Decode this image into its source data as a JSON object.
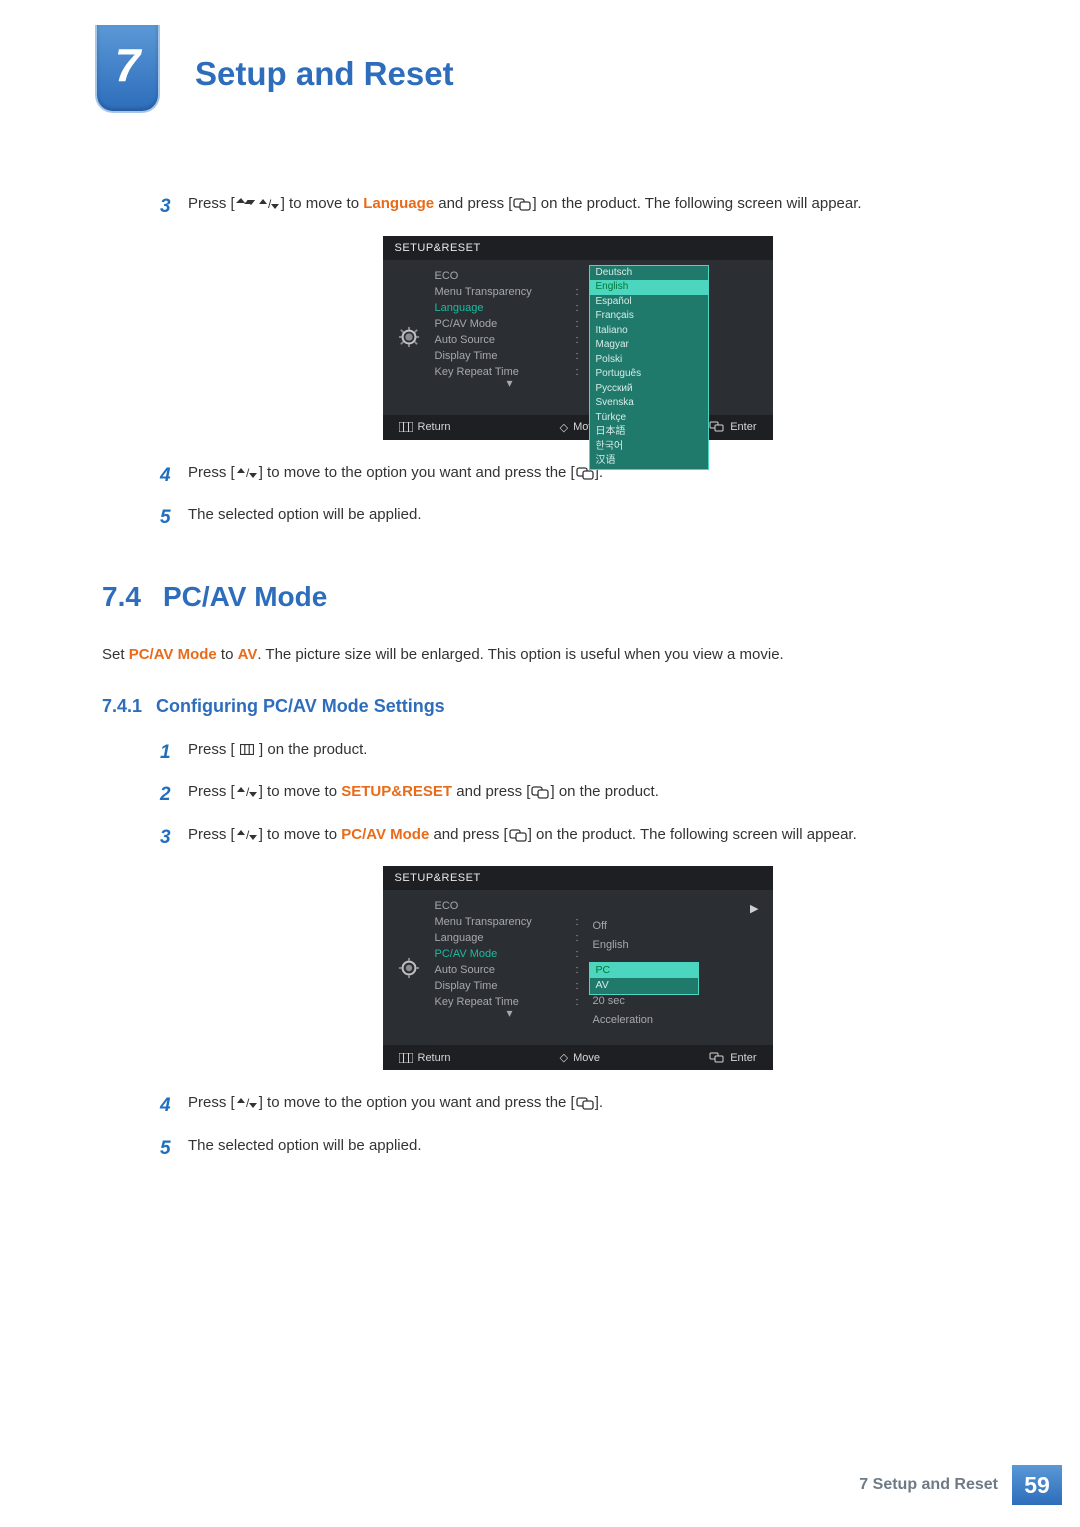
{
  "header": {
    "chapter_number": "7",
    "chapter_title": "Setup and Reset"
  },
  "steps_a": {
    "s3": {
      "num": "3",
      "pre": "Press [",
      "mid1": "] to move to ",
      "hl": "Language",
      "mid2": " and press [",
      "post": "] on the product. The following screen will appear."
    },
    "s4": {
      "num": "4",
      "pre": "Press [",
      "mid": "] to move to the option you want and press the [",
      "post": "]."
    },
    "s5": {
      "num": "5",
      "text": "The selected option will be applied."
    }
  },
  "osd1": {
    "title": "SETUP&RESET",
    "items": [
      "ECO",
      "Menu Transparency",
      "Language",
      "PC/AV Mode",
      "Auto Source",
      "Display Time",
      "Key Repeat Time"
    ],
    "selected_index": 2,
    "dropdown": [
      "Deutsch",
      "English",
      "Español",
      "Français",
      "Italiano",
      "Magyar",
      "Polski",
      "Português",
      "Русский",
      "Svenska",
      "Türkçe",
      "日本語",
      "한국어",
      "汉语"
    ],
    "dropdown_hl_index": 1,
    "footer": {
      "return": "Return",
      "move": "Move",
      "enter": "Enter"
    }
  },
  "section": {
    "num": "7.4",
    "title": "PC/AV Mode"
  },
  "body_text": {
    "pre": "Set ",
    "hl1": "PC/AV Mode",
    "mid": " to ",
    "hl2": "AV",
    "post": ". The picture size will be enlarged. This option is useful when you view a movie."
  },
  "subsection": {
    "num": "7.4.1",
    "title": "Configuring PC/AV Mode Settings"
  },
  "steps_b": {
    "s1": {
      "num": "1",
      "pre": "Press [ ",
      "post": " ] on the product."
    },
    "s2": {
      "num": "2",
      "pre": "Press [",
      "mid1": "] to move to ",
      "hl": "SETUP&RESET",
      "mid2": " and press [",
      "post": "] on the product."
    },
    "s3": {
      "num": "3",
      "pre": "Press [",
      "mid1": "] to move to ",
      "hl": "PC/AV Mode",
      "mid2": " and press [",
      "post": "] on the product. The following screen will appear."
    },
    "s4": {
      "num": "4",
      "pre": "Press [",
      "mid": "] to move to the option you want and press the [",
      "post": "]."
    },
    "s5": {
      "num": "5",
      "text": "The selected option will be applied."
    }
  },
  "osd2": {
    "title": "SETUP&RESET",
    "items": [
      "ECO",
      "Menu Transparency",
      "Language",
      "PC/AV Mode",
      "Auto Source",
      "Display Time",
      "Key Repeat Time"
    ],
    "selected_index": 3,
    "values": [
      "",
      "Off",
      "English",
      "",
      "",
      "20 sec",
      "Acceleration"
    ],
    "dropdown": [
      "PC",
      "AV"
    ],
    "dropdown_hl_index": 0,
    "footer": {
      "return": "Return",
      "move": "Move",
      "enter": "Enter"
    }
  },
  "footer": {
    "text": "7 Setup and Reset",
    "page": "59"
  }
}
